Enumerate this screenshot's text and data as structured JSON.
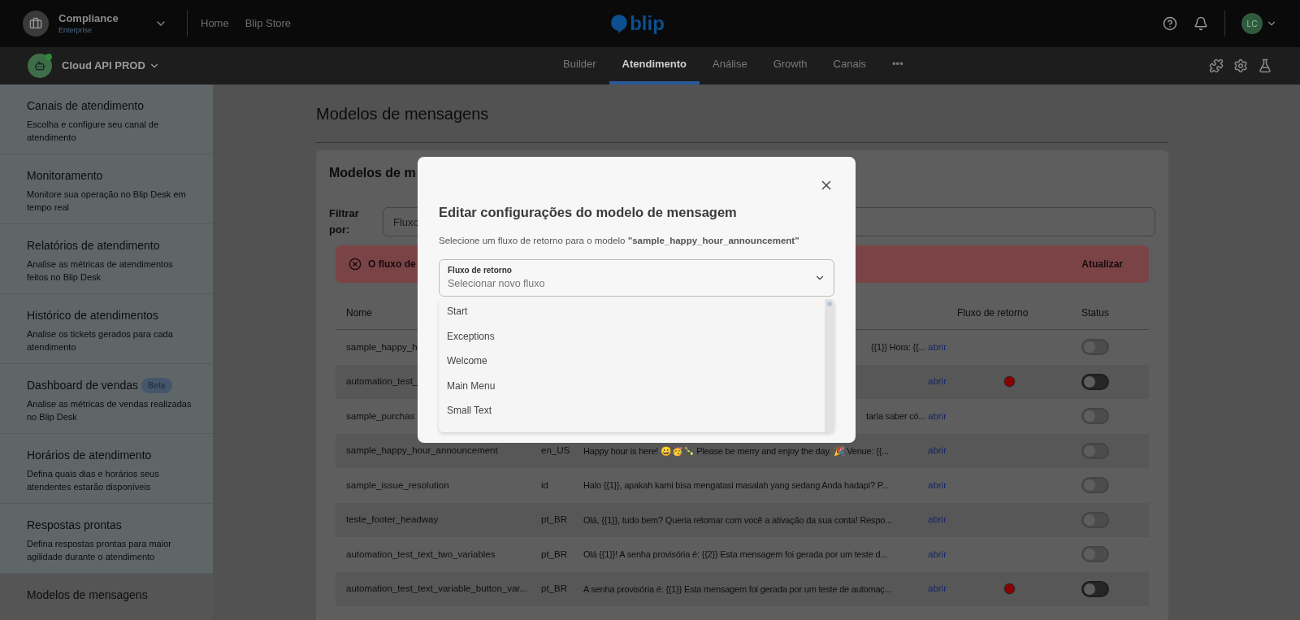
{
  "top_bar": {
    "workspace": {
      "name": "Compliance",
      "plan": "Enterprise"
    },
    "links": [
      "Home",
      "Blip Store"
    ],
    "logo": "blip",
    "avatar": "LC"
  },
  "bot_bar": {
    "bot_name": "Cloud API PROD",
    "tabs": [
      {
        "label": "Builder",
        "selected": false
      },
      {
        "label": "Atendimento",
        "selected": true
      },
      {
        "label": "Análise",
        "selected": false
      },
      {
        "label": "Growth",
        "selected": false
      },
      {
        "label": "Canais",
        "selected": false
      },
      {
        "label": "•••",
        "selected": false
      }
    ]
  },
  "sidebar": {
    "items": [
      {
        "title": "Canais de atendimento",
        "description": "Escolha e configure seu canal de atendimento",
        "selected": false
      },
      {
        "title": "Monitoramento",
        "description": "Monitore sua operação no Blip Desk em tempo real",
        "selected": false
      },
      {
        "title": "Relatórios de atendimento",
        "description": "Analise as métricas de atendimentos feitos no Blip Desk",
        "selected": false
      },
      {
        "title": "Histórico de atendimentos",
        "description": "Analise os tickets gerados para cada atendimento",
        "selected": false
      },
      {
        "title": "Dashboard de vendas",
        "badge": "Beta",
        "description": "Analise as métricas de vendas realizadas no Blip Desk",
        "selected": false
      },
      {
        "title": "Horários de atendimento",
        "description": "Defina quais dias e horários seus atendentes estarão disponíveis",
        "selected": false
      },
      {
        "title": "Respostas prontas",
        "description": "Defina respostas prontas para maior agilidade durante o atendimento",
        "selected": false
      },
      {
        "title": "Modelos de mensagens",
        "selected": true
      }
    ]
  },
  "page": {
    "title": "Modelos de mensagens",
    "card_title": "Modelos de m",
    "filter_label": "Filtrar por:",
    "filter_placeholder": "Fluxo",
    "alert": {
      "text": "O fluxo de",
      "action": "Atualizar"
    },
    "columns": {
      "name": "Nome",
      "return_flow": "Fluxo de retorno",
      "status": "Status"
    },
    "rows": [
      {
        "name": "sample_happy_h",
        "message": "{{1}} Hora: {{...",
        "link": "abrir",
        "return_flow_error": false,
        "status": {
          "on": false,
          "disabled": true
        }
      },
      {
        "name": "automation_test_",
        "link": "abrir",
        "return_flow_error": true,
        "status": {
          "on": false,
          "disabled": false
        }
      },
      {
        "name": "sample_purchas",
        "message": "taría saber có...",
        "link": "abrir",
        "return_flow_error": false,
        "status": {
          "on": false,
          "disabled": true
        }
      },
      {
        "name": "sample_happy_hour_announcement",
        "language": "en_US",
        "message": "Happy hour is here! 😀🥳🍾 Please be merry and enjoy the day. 🎉 Venue: {{...",
        "link": "abrir",
        "return_flow_error": false,
        "status": {
          "on": false,
          "disabled": true
        }
      },
      {
        "name": "sample_issue_resolution",
        "language": "id",
        "message": "Halo {{1}}, apakah kami bisa mengatasi masalah yang sedang Anda hadapi? P...",
        "link": "abrir",
        "return_flow_error": false,
        "status": {
          "on": false,
          "disabled": true
        }
      },
      {
        "name": "teste_footer_headway",
        "language": "pt_BR",
        "message": "Olá, {{1}}, tudo bem? Queria retomar com você a ativação da sua conta! Respo...",
        "link": "abrir",
        "return_flow_error": false,
        "status": {
          "on": false,
          "disabled": true
        }
      },
      {
        "name": "automation_test_text_two_variables",
        "language": "pt_BR",
        "message": "Olá {{1}}! A senha provisória é: {{2}} Esta mensagem foi gerada por um teste d...",
        "link": "abrir",
        "return_flow_error": false,
        "status": {
          "on": false,
          "disabled": true
        }
      },
      {
        "name": "automation_test_text_variable_button_var...",
        "language": "pt_BR",
        "message": "A senha provisória é: {{1}} Esta mensagem foi gerada por um teste de automaç...",
        "link": "abrir",
        "return_flow_error": true,
        "status": {
          "on": false,
          "disabled": false
        }
      }
    ]
  },
  "modal": {
    "title": "Editar configurações do modelo de mensagem",
    "description": "Selecione um fluxo de retorno para o modelo **\"sample_happy_hour_announcement\"**",
    "select": {
      "label": "Fluxo de retorno",
      "placeholder": "Selecionar novo fluxo"
    },
    "options": [
      "Start",
      "Exceptions",
      "Welcome",
      "Main Menu",
      "Small Text"
    ]
  }
}
